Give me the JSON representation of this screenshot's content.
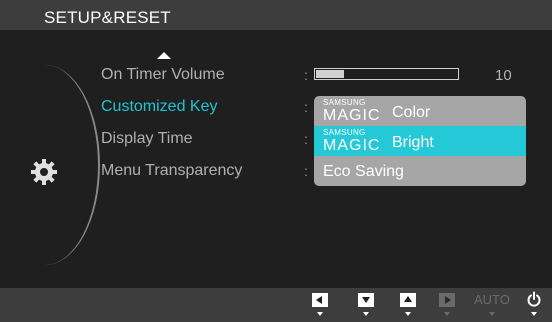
{
  "header": {
    "title": "SETUP&RESET"
  },
  "menu": {
    "items": [
      {
        "label": "On Timer  Volume",
        "selected": false
      },
      {
        "label": "Customized Key",
        "selected": true
      },
      {
        "label": "Display Time",
        "selected": false
      },
      {
        "label": "Menu Transparency",
        "selected": false
      }
    ],
    "colon": ":"
  },
  "volume": {
    "value": "10",
    "level_fraction": 0.2
  },
  "dropdown": {
    "options": [
      {
        "brand_small": "SAMSUNG",
        "brand_large": "MAGIC",
        "text": "Color",
        "selected": false
      },
      {
        "brand_small": "SAMSUNG",
        "brand_large": "MAGIC",
        "text": "Bright",
        "selected": true
      },
      {
        "text": "Eco Saving",
        "selected": false
      }
    ]
  },
  "bottom_bar": {
    "buttons": [
      {
        "icon": "left-arrow-icon",
        "enabled": true
      },
      {
        "icon": "down-arrow-icon",
        "enabled": true
      },
      {
        "icon": "up-arrow-icon",
        "enabled": true
      },
      {
        "icon": "right-arrow-icon",
        "enabled": false
      }
    ],
    "auto_label": "AUTO",
    "power_icon": "power-icon"
  },
  "colors": {
    "background": "#1f1f1f",
    "bar": "#3d3d3d",
    "accent": "#25c8d6",
    "selected_text": "#1fc4d3",
    "menu_text": "#b0b0b0",
    "dropdown_bg": "#a6a6a6"
  },
  "icons": {
    "scroll_up": "up-triangle-icon",
    "category": "gear-icon"
  }
}
